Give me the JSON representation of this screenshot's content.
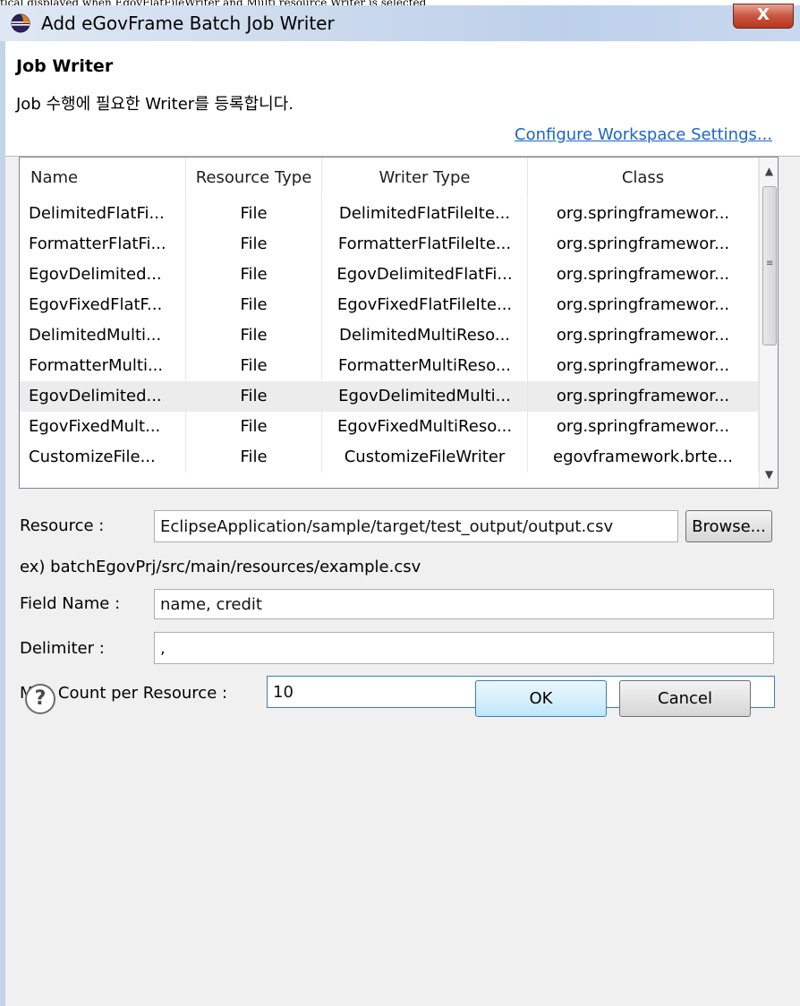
{
  "caption_fragment": "tical displayed when EgovFlatFileWriter and Multi resource Writer is selected",
  "window": {
    "title": "Add eGovFrame Batch Job Writer",
    "close_glyph": "X"
  },
  "header": {
    "title": "Job Writer",
    "description": "Job 수행에 필요한 Writer를 등록합니다.",
    "link": "Configure Workspace Settings..."
  },
  "table": {
    "columns": [
      "Name",
      "Resource Type",
      "Writer Type",
      "Class"
    ],
    "rows": [
      {
        "name": "DelimitedFlatFi...",
        "resource_type": "File",
        "writer_type": "DelimitedFlatFileIte...",
        "class": "org.springframewor..."
      },
      {
        "name": "FormatterFlatFi...",
        "resource_type": "File",
        "writer_type": "FormatterFlatFileIte...",
        "class": "org.springframewor..."
      },
      {
        "name": "EgovDelimited...",
        "resource_type": "File",
        "writer_type": "EgovDelimitedFlatFi...",
        "class": "org.springframewor..."
      },
      {
        "name": "EgovFixedFlatF...",
        "resource_type": "File",
        "writer_type": "EgovFixedFlatFileIte...",
        "class": "org.springframewor..."
      },
      {
        "name": "DelimitedMulti...",
        "resource_type": "File",
        "writer_type": "DelimitedMultiReso...",
        "class": "org.springframewor..."
      },
      {
        "name": "FormatterMulti...",
        "resource_type": "File",
        "writer_type": "FormatterMultiReso...",
        "class": "org.springframewor..."
      },
      {
        "name": "EgovDelimited...",
        "resource_type": "File",
        "writer_type": "EgovDelimitedMulti...",
        "class": "org.springframewor..."
      },
      {
        "name": "EgovFixedMult...",
        "resource_type": "File",
        "writer_type": "EgovFixedMultiReso...",
        "class": "org.springframewor..."
      },
      {
        "name": "CustomizeFile...",
        "resource_type": "File",
        "writer_type": "CustomizeFileWriter",
        "class": "egovframework.brte..."
      }
    ],
    "selected_row": 6
  },
  "form": {
    "resource_label": "Resource :",
    "resource_value": "EclipseApplication/sample/target/test_output/output.csv",
    "browse_label": "Browse...",
    "example_text": "ex) batchEgovPrj/src/main/resources/example.csv",
    "field_name_label": "Field Name :",
    "field_name_value": "name, credit",
    "delimiter_label": "Delimiter :",
    "delimiter_value": ",",
    "max_count_label": "Max Count per Resource :",
    "max_count_value": "10"
  },
  "footer": {
    "help_glyph": "?",
    "ok_label": "OK",
    "cancel_label": "Cancel"
  }
}
